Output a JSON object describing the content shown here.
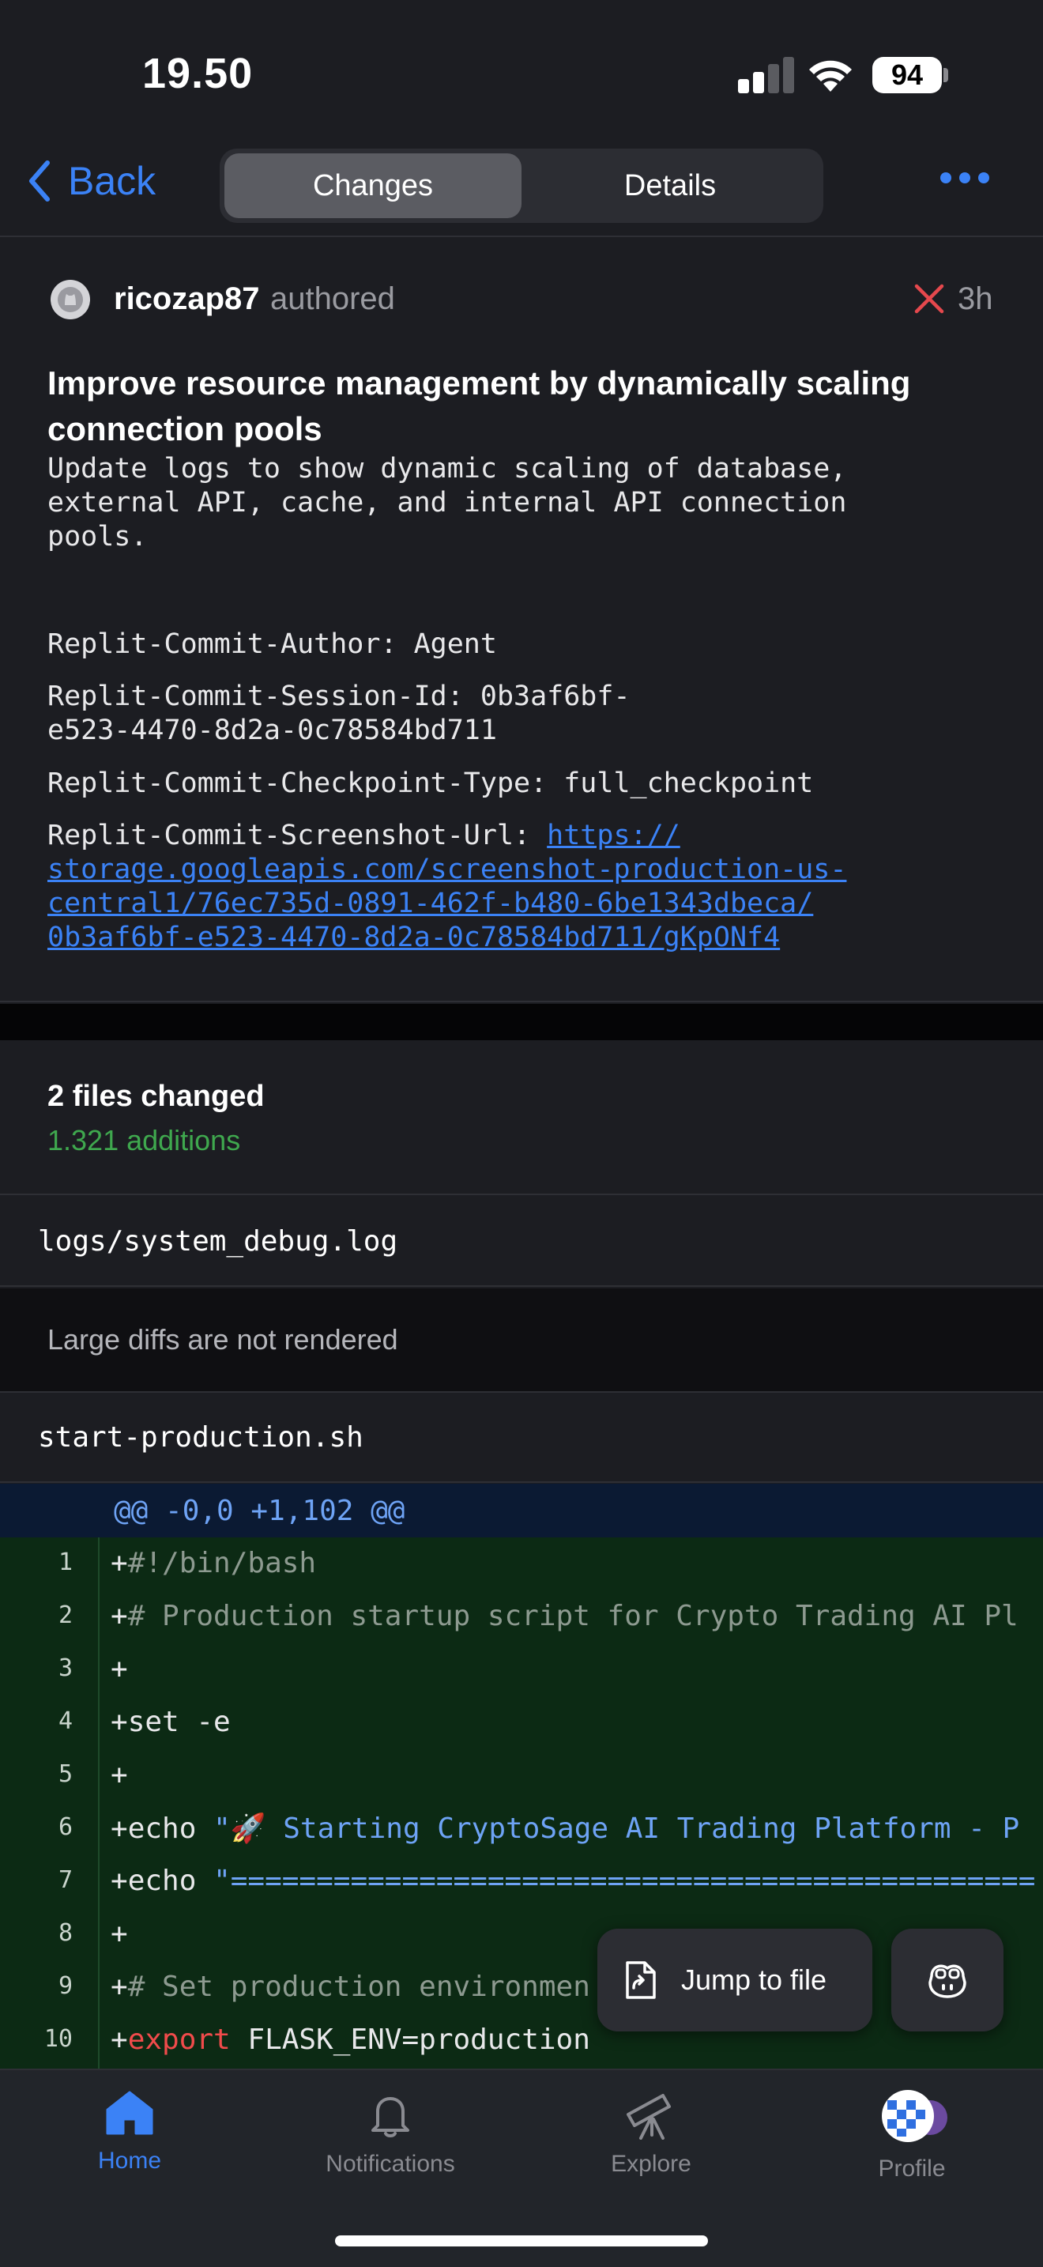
{
  "status_bar": {
    "time": "19.50",
    "battery": "94"
  },
  "nav": {
    "back_label": "Back",
    "tabs": [
      {
        "label": "Changes",
        "active": true
      },
      {
        "label": "Details",
        "active": false
      }
    ]
  },
  "commit": {
    "author": "ricozap87",
    "action": "authored",
    "status_icon": "x-icon",
    "age": "3h",
    "title": "Improve resource management by dynamically scaling connection pools",
    "body": "Update logs to show dynamic scaling of database,\nexternal API, cache, and internal API connection\npools.",
    "trailers": {
      "author": "Replit-Commit-Author: Agent",
      "session_id": "Replit-Commit-Session-Id: 0b3af6bf-\ne523-4470-8d2a-0c78584bd711",
      "checkpoint_type": "Replit-Commit-Checkpoint-Type: full_checkpoint",
      "screenshot_prefix": "Replit-Commit-Screenshot-Url: ",
      "screenshot_url_1": "https://",
      "screenshot_url_2": "storage.googleapis.com/screenshot-production-us-",
      "screenshot_url_3": "central1/76ec735d-0891-462f-b480-6be1343dbeca/",
      "screenshot_url_4": "0b3af6bf-e523-4470-8d2a-0c78584bd711/gKpONf4"
    }
  },
  "files": {
    "count_label": "2 files changed",
    "additions_label": "1.321 additions",
    "items": [
      {
        "name": "logs/system_debug.log",
        "note": "Large diffs are not rendered"
      },
      {
        "name": "start-production.sh"
      }
    ]
  },
  "diff": {
    "hunk_header": "@@ -0,0 +1,102 @@",
    "lines": [
      {
        "n": "1",
        "plus": "+",
        "parts": [
          {
            "t": "#!/bin/bash",
            "c": "c"
          }
        ]
      },
      {
        "n": "2",
        "plus": "+",
        "parts": [
          {
            "t": "# Production startup script for Crypto Trading AI Pl",
            "c": "c"
          }
        ]
      },
      {
        "n": "3",
        "plus": "+",
        "parts": []
      },
      {
        "n": "4",
        "plus": "+",
        "parts": [
          {
            "t": "set -e",
            "c": ""
          }
        ]
      },
      {
        "n": "5",
        "plus": "+",
        "parts": []
      },
      {
        "n": "6",
        "plus": "+",
        "parts": [
          {
            "t": "echo ",
            "c": ""
          },
          {
            "t": "\"🚀 Starting CryptoSage AI Trading Platform - P",
            "c": "s"
          }
        ]
      },
      {
        "n": "7",
        "plus": "+",
        "parts": [
          {
            "t": "echo ",
            "c": ""
          },
          {
            "t": "\"===============================================",
            "c": "s"
          }
        ]
      },
      {
        "n": "8",
        "plus": "+",
        "parts": []
      },
      {
        "n": "9",
        "plus": "+",
        "parts": [
          {
            "t": "# Set production environmen",
            "c": "c"
          }
        ]
      },
      {
        "n": "10",
        "plus": "+",
        "parts": [
          {
            "t": "export",
            "c": "k"
          },
          {
            "t": " FLASK_ENV=production",
            "c": ""
          }
        ]
      }
    ]
  },
  "floating": {
    "jump_label": "Jump to file"
  },
  "tabbar": {
    "items": [
      {
        "label": "Home",
        "icon": "home-icon",
        "active": true
      },
      {
        "label": "Notifications",
        "icon": "bell-icon",
        "active": false
      },
      {
        "label": "Explore",
        "icon": "telescope-icon",
        "active": false
      },
      {
        "label": "Profile",
        "icon": "avatar",
        "active": false
      }
    ]
  },
  "colors": {
    "accent": "#3b82f6",
    "addition_green": "#3fa84e",
    "diff_bg": "#0c2a14",
    "hunk_bg": "#0b1a33",
    "error_red": "#e5484d"
  }
}
